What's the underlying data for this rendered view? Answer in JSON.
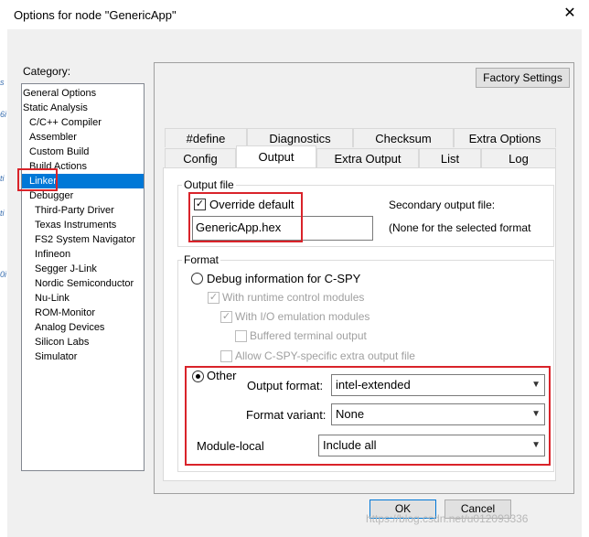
{
  "window": {
    "title": "Options for node \"GenericApp\"",
    "close_glyph": "✕"
  },
  "edge_marks": [
    "s",
    "6i",
    "ti",
    "ti",
    "0i"
  ],
  "category": {
    "label": "Category:",
    "items": [
      "General Options",
      "Static Analysis",
      "C/C++ Compiler",
      "Assembler",
      "Custom Build",
      "Build Actions",
      "Linker",
      "Debugger",
      "Third-Party Driver",
      "Texas Instruments",
      "FS2 System Navigator",
      "Infineon",
      "Segger J-Link",
      "Nordic Semiconductor",
      "Nu-Link",
      "ROM-Monitor",
      "Analog Devices",
      "Silicon Labs",
      "Simulator"
    ],
    "selected": "Linker"
  },
  "factory_settings": "Factory Settings",
  "tabs_row1": [
    "#define",
    "Diagnostics",
    "Checksum",
    "Extra Options"
  ],
  "tabs_row2": [
    "Config",
    "Output",
    "Extra Output",
    "List",
    "Log"
  ],
  "active_tab": "Output",
  "output_file": {
    "group_label": "Output file",
    "override_label": "Override default",
    "override_checked": true,
    "filename": "GenericApp.hex",
    "secondary_label": "Secondary output file:",
    "secondary_value": "(None for the selected format"
  },
  "format": {
    "group_label": "Format",
    "debug_info": "Debug information for C-SPY",
    "runtime_control": "With runtime control modules",
    "io_emulation": "With I/O emulation modules",
    "buffered_terminal": "Buffered terminal output",
    "allow_cspy": "Allow C-SPY-specific extra output file",
    "other": "Other",
    "output_format_label": "Output format:",
    "output_format_value": "intel-extended",
    "format_variant_label": "Format variant:",
    "format_variant_value": "None",
    "module_local_label": "Module-local",
    "module_local_value": "Include all"
  },
  "buttons": {
    "ok": "OK",
    "cancel": "Cancel"
  },
  "watermark": "https://blog.csdn.net/u012093336"
}
